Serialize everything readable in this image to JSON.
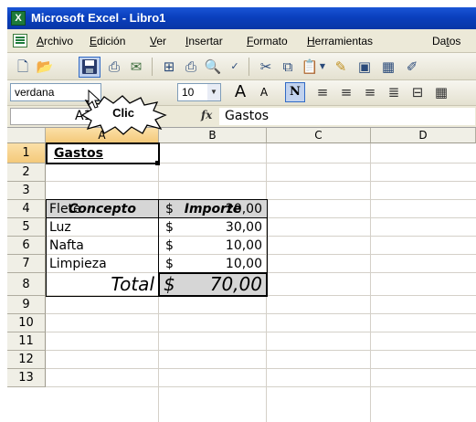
{
  "window": {
    "title": "Microsoft Excel - Libro1"
  },
  "menu": {
    "items": [
      {
        "u": "A",
        "rest": "rchivo"
      },
      {
        "u": "E",
        "rest": "dición"
      },
      {
        "u": "V",
        "rest": "er"
      },
      {
        "u": "I",
        "rest": "nsertar"
      },
      {
        "u": "F",
        "rest": "ormato"
      },
      {
        "u": "H",
        "rest": "erramientas"
      },
      {
        "pre": "Da",
        "u": "t",
        "rest": "os"
      }
    ]
  },
  "format_toolbar": {
    "font_name": "verdana",
    "font_size": "10"
  },
  "callout": {
    "label": "Clic"
  },
  "formula_bar": {
    "name_box": "A1",
    "fx": "fx",
    "content": "Gastos"
  },
  "grid": {
    "columns": [
      "A",
      "B",
      "C",
      "D"
    ],
    "rows": [
      "1",
      "2",
      "3",
      "4",
      "5",
      "6",
      "7",
      "8",
      "9",
      "10",
      "11",
      "12",
      "13"
    ],
    "selected_column": "A",
    "selected_row": "1"
  },
  "sheet": {
    "title": "Gastos",
    "header_concepto": "Concepto",
    "header_importe": "Importe",
    "items": [
      {
        "concepto": "Flete",
        "currency": "$",
        "importe": "20,00"
      },
      {
        "concepto": "Luz",
        "currency": "$",
        "importe": "30,00"
      },
      {
        "concepto": "Nafta",
        "currency": "$",
        "importe": "10,00"
      },
      {
        "concepto": "Limpieza",
        "currency": "$",
        "importe": "10,00"
      }
    ],
    "total_label": "Total",
    "total_currency": "$",
    "total_value": "70,00"
  },
  "colors": {
    "title_bar": "#0a3fbd",
    "selected_header": "#f4c97a",
    "shaded_cells": "#d6d6d6"
  }
}
